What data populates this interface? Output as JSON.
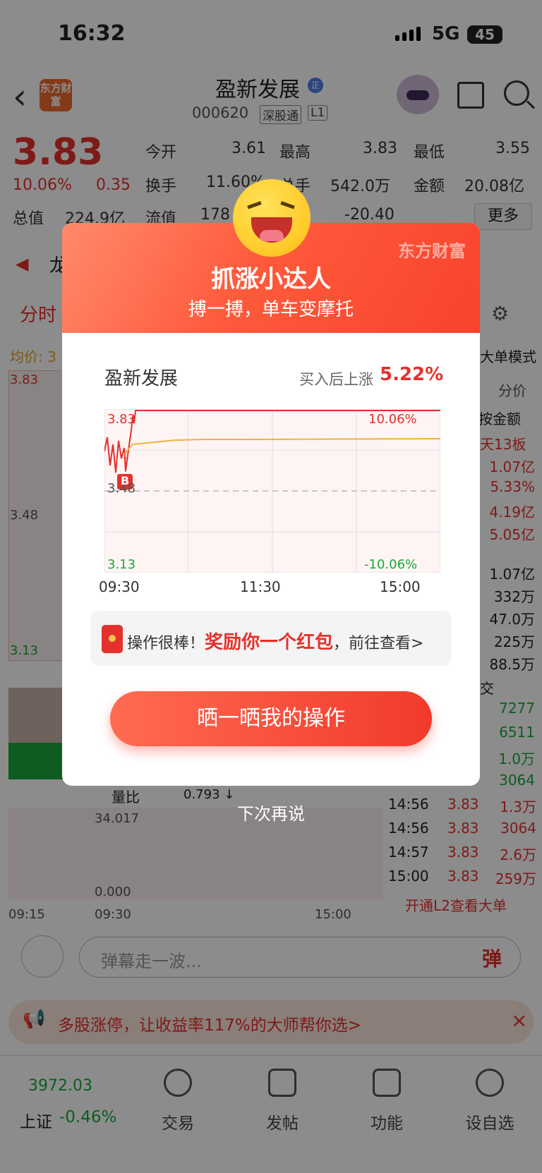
{
  "status": {
    "time": "16:32",
    "network": "5G",
    "battery": "45"
  },
  "header": {
    "back_icon": "back-arrow-icon",
    "logo_text": "东方财富",
    "stock_name": "盈新发展",
    "badge": "正",
    "code": "000620",
    "tags": [
      "深股通",
      "L1"
    ]
  },
  "quote": {
    "price": "3.83",
    "pct": "10.06%",
    "change": "0.35",
    "rows": [
      [
        {
          "l": "今开",
          "v": "3.61"
        },
        {
          "l": "最高",
          "v": "3.83"
        },
        {
          "l": "最低",
          "v": "3.55"
        }
      ],
      [
        {
          "l": "换手",
          "v": "11.60%"
        },
        {
          "l": "总手",
          "v": "542.0万"
        },
        {
          "l": "金额",
          "v": "20.08亿"
        }
      ]
    ],
    "row3": {
      "l1": "总值",
      "v1": "224.9亿",
      "l2": "流值",
      "v2": "178",
      "v3": "-20.40"
    },
    "more": "更多"
  },
  "background": {
    "dragon": "龙",
    "tab": "分时",
    "avg": "均价: 3",
    "left_ticks": [
      "3.83",
      "3.48",
      "3.13"
    ],
    "mode": "大单模式",
    "fenjia": "分价",
    "by_amount": "按金额",
    "ban": "天13板",
    "right_values": [
      "1.07亿",
      "5.33%",
      "4.19亿",
      "5.05亿",
      "1.07亿",
      "332万",
      "47.0万",
      "225万",
      "88.5万"
    ],
    "jiao": "交",
    "vols": [
      "7277",
      "6511",
      "1.0万",
      "3064"
    ],
    "ticks": [
      {
        "t": "14:56",
        "p": "3.83",
        "v": "1.3万"
      },
      {
        "t": "14:56",
        "p": "3.83",
        "v": "3064"
      },
      {
        "t": "14:57",
        "p": "3.83",
        "v": "2.6万"
      },
      {
        "t": "15:00",
        "p": "3.83",
        "v": "259万"
      }
    ],
    "l2": "开通L2查看大单",
    "liangbi": "量比",
    "liangbi_val": "0.793 ↓",
    "vol_top": "34.017",
    "vol_bottom": "0.000",
    "vol_x": [
      "09:15",
      "09:30",
      "15:00"
    ]
  },
  "input": {
    "placeholder": "弹幕走一波...",
    "send": "弹"
  },
  "banner": {
    "text": "多股涨停，让收益率117%的大师帮你选>",
    "close": "×"
  },
  "nav": {
    "index_value": "3972.03",
    "index_name": "上证",
    "index_pct": "-0.46%",
    "items": [
      "交易",
      "发帖",
      "功能",
      "设自选"
    ]
  },
  "modal": {
    "brand": "东方财富",
    "title": "抓涨小达人",
    "subtitle": "搏一搏，单车变摩托",
    "stock": "盈新发展",
    "up_label": "买入后上涨",
    "up_value": "5.22%",
    "chart_labels": {
      "top_left": "3.83",
      "top_right": "10.06%",
      "mid": "3.48",
      "bottom_left": "3.13",
      "bottom_right": "-10.06%",
      "buy_marker": "B"
    },
    "x_labels": [
      "09:30",
      "11:30",
      "15:00"
    ],
    "reward_prefix": "操作很棒！",
    "reward_highlight": "奖励你一个红包",
    "reward_suffix": "，前往查看>",
    "share_button": "晒一晒我的操作",
    "later": "下次再说"
  },
  "colors": {
    "up": "#e5312d",
    "down": "#1aa83a",
    "avg_line": "#f0b23c",
    "accent": "#f4432c"
  }
}
